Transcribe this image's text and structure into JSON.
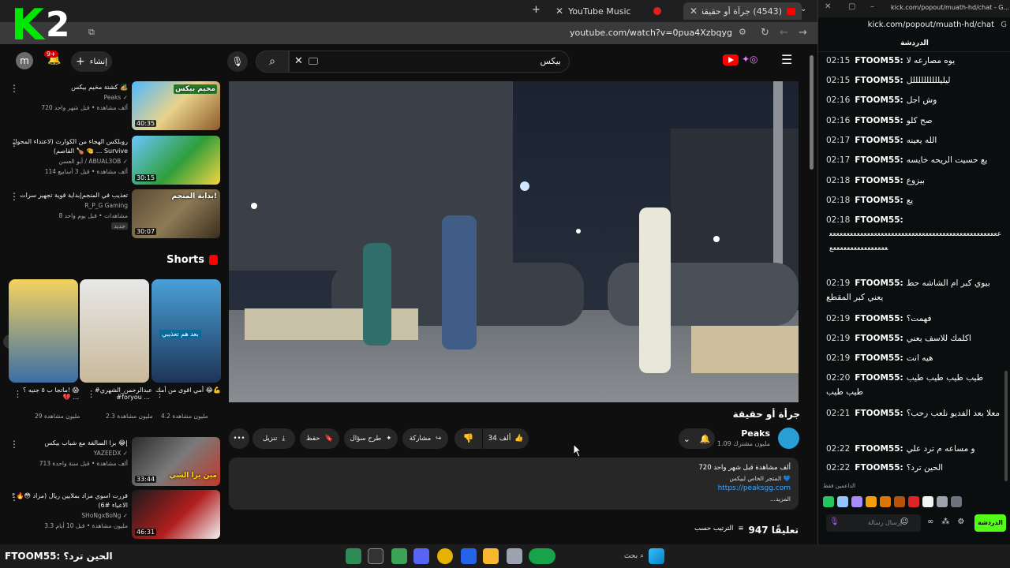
{
  "browser": {
    "tabs": [
      {
        "label": "(4543) جرأة أو حقيقة - YouTube",
        "active": true
      },
      {
        "label": "YouTube Music",
        "active": false
      }
    ],
    "url": "youtube.com/watch?v=0pua4Xzbqyg"
  },
  "overlay_logo": {
    "k": "K",
    "two": "2"
  },
  "masthead": {
    "avatar_letter": "m",
    "notif_badge": "9+",
    "create_label": "إنشاء",
    "search_query": "بيكس"
  },
  "recommended": [
    {
      "title": "كشتة مخيم بيكس 🏕️",
      "channel": "Peaks ✓",
      "channel2": "+Peaks",
      "meta": "720 ألف مشاهدة • قبل شهر واحد",
      "duration": "40:35",
      "thumb_text": "مخيم بيكس"
    },
    {
      "title": "روبلكس الهجاء من الكوارث (لاعتداء المحول القاصم) 🍗 🤏 ... Survive",
      "channel": "أبو العسن / ABUAL3OB ✓",
      "meta": "114 ألف مشاهدة • قبل 3 أسابيع",
      "duration": "30:15",
      "thumb_text": ""
    },
    {
      "title": "تعذيب في المنجم|بداية قوية تجهيز سرات",
      "channel": "R_P_G Gaming",
      "meta": "8 مشاهدات • قبل يوم واحد",
      "badge": "جديد",
      "duration": "30:07",
      "thumb_text": "بداية المنجم!"
    }
  ],
  "shorts": {
    "title": "Shorts",
    "items": [
      {
        "title": "أمي اقوى من أمك 😂💪",
        "views": "4.2 مليون مشاهدة",
        "thumb_text": "بعد هم تعذيبي"
      },
      {
        "title": "#عبدالرحمن_الشهري #foryou ...",
        "views": "2.3 مليون مشاهدة",
        "thumb_text": ""
      },
      {
        "title": "ماتجا ب ٥ جنيه ؟! 😱💔 ...",
        "views": "29 مليون مشاهدة",
        "thumb_text": ""
      }
    ]
  },
  "recommended2": [
    {
      "title": "برا السالفة مع شباب بيكس 😂|",
      "channel": "YAZEEDX ✓",
      "meta": "713 ألف مشاهدة • قبل سنة واحدة",
      "duration": "33:44",
      "thumb_text": "مين برا الشي"
    },
    {
      "title": "! 🔥😳 قررت اسوي مزاد بملايين ريال (مزاد الاعياء #6)",
      "channel": "SHoNgxBoNg ✓",
      "meta": "3.3 مليون مشاهدة • قبل 10 أيام",
      "duration": "46:31",
      "thumb_text": ""
    }
  ],
  "video": {
    "title": "جرأة أو حقيقة",
    "channel": "Peaks",
    "subscribers": "1.09 مليون مشترك",
    "likes": "34 ألف",
    "share": "مشاركة",
    "ask": "طرح سؤال",
    "save": "حفظ",
    "download": "تنزيل",
    "desc_line1": "720 ألف مشاهدة  قبل شهر واحد",
    "desc_line2": "المتجر الخاص لبيكس 💙",
    "desc_link": "https://peaksgg.com",
    "desc_more": "...المزيد",
    "comments_count": "947 تعليقًا",
    "sort_label": "الترتيب حسب"
  },
  "kick": {
    "url_bar": "kick.com/popout/muath-hd/chat - G...",
    "url": "kick.com/popout/muath-hd/chat",
    "header": "الدردشة",
    "messages": [
      {
        "time": "02:15",
        "user": "FTOOM55:",
        "body": "يوه مصارعه لا"
      },
      {
        "time": "02:15",
        "user": "FTOOM55:",
        "body": "ليليللللللللللل"
      },
      {
        "time": "02:16",
        "user": "FTOOM55:",
        "body": "وش اجل"
      },
      {
        "time": "02:16",
        "user": "FTOOM55:",
        "body": "صح كلو"
      },
      {
        "time": "02:17",
        "user": "FTOOM55:",
        "body": "الله يعينه"
      },
      {
        "time": "02:17",
        "user": "FTOOM55:",
        "body": "يع حسيت الريحه خايسه"
      },
      {
        "time": "02:18",
        "user": "FTOOM55:",
        "body": "بيزوع"
      },
      {
        "time": "02:18",
        "user": "FTOOM55:",
        "body": "يع"
      },
      {
        "time": "02:18",
        "user": "FTOOM55:",
        "body": "ععععععععععععععععععععععععععععععععععععععععععععععععععععععععععععععععععع"
      },
      {
        "time": "02:19",
        "user": "FTOOM55:",
        "body": "بيوي كبر ام الشاشه حط يعني كبر المقطع"
      },
      {
        "time": "02:19",
        "user": "FTOOM55:",
        "body": "فهمت؟"
      },
      {
        "time": "02:19",
        "user": "FTOOM55:",
        "body": "اكلمك للاسف يعني"
      },
      {
        "time": "02:19",
        "user": "FTOOM55:",
        "body": "هيه انت"
      },
      {
        "time": "02:20",
        "user": "FTOOM55:",
        "body": "طيب طيب طيب طيب طيب طيب"
      },
      {
        "time": "02:21",
        "user": "FTOOM55:",
        "body": "معلا بعد الفديو نلعب رحب؟"
      },
      {
        "time": "02:22",
        "user": "FTOOM55:",
        "body": "و مساعه م ترد علي"
      },
      {
        "time": "02:22",
        "user": "FTOOM55:",
        "body": "الحين ترد؟"
      }
    ],
    "top_label": "الداعمين فقط",
    "input_placeholder": "إرسال رسالة",
    "send_label": "الدردشة"
  },
  "taskbar": {
    "caption": "FTOOM55: الحين ترد؟",
    "search_label": "بحث"
  }
}
